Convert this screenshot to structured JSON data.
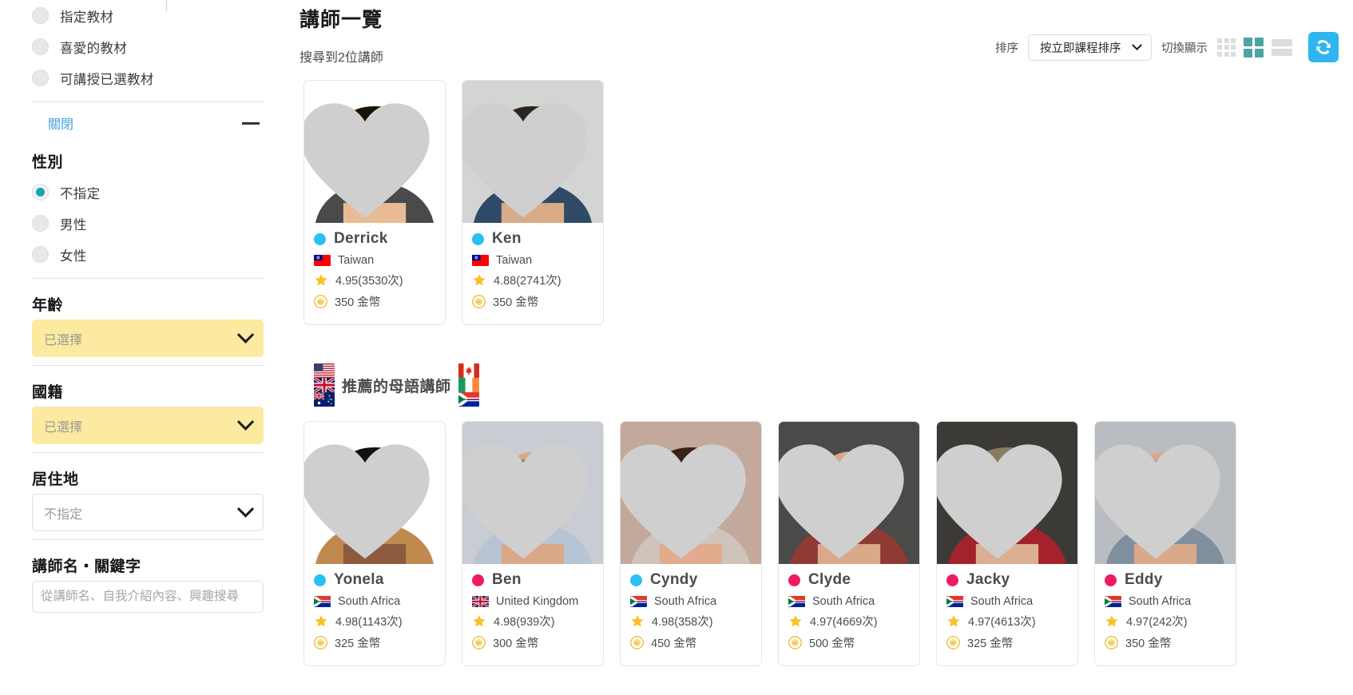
{
  "sidebar": {
    "material_options": [
      {
        "label": "指定教材",
        "checked": false
      },
      {
        "label": "喜愛的教材",
        "checked": false
      },
      {
        "label": "可講授已選教材",
        "checked": false
      }
    ],
    "collapse": {
      "label": "關閉",
      "icon": "minus-icon"
    },
    "gender": {
      "title": "性別",
      "options": [
        {
          "label": "不指定",
          "checked": true
        },
        {
          "label": "男性",
          "checked": false
        },
        {
          "label": "女性",
          "checked": false
        }
      ]
    },
    "age": {
      "title": "年齡",
      "value": "已選擇",
      "highlighted": true
    },
    "nationality": {
      "title": "國籍",
      "value": "已選擇",
      "highlighted": true
    },
    "residence": {
      "title": "居住地",
      "value": "不指定",
      "highlighted": false
    },
    "keyword": {
      "title": "講師名・關鍵字",
      "placeholder": "從講師名、自我介紹內容、興趣搜尋",
      "value": ""
    }
  },
  "main": {
    "page_title": "講師一覽",
    "result_count": "搜尋到2位講師",
    "toolbar": {
      "sort_label": "排序",
      "sort_value": "按立即課程排序",
      "view_label": "切換顯示",
      "views": [
        {
          "name": "grid-3-col",
          "active": false
        },
        {
          "name": "grid-2-col",
          "active": true
        },
        {
          "name": "list-view",
          "active": false
        }
      ],
      "refresh_icon": "refresh-icon"
    },
    "teachers": [
      {
        "name": "Derrick",
        "status_color": "#29c0f2",
        "country": "Taiwan",
        "flag": "tw",
        "rating": "4.95(3530次)",
        "price": "350 金幣",
        "favorite": false
      },
      {
        "name": "Ken",
        "status_color": "#29c0f2",
        "country": "Taiwan",
        "flag": "tw",
        "rating": "4.88(2741次)",
        "price": "350 金幣",
        "favorite": false
      }
    ],
    "recommend_section": {
      "flags_before": [
        "us",
        "gb",
        "au"
      ],
      "title": "推薦的母語講師",
      "flags_after": [
        "ca",
        "ie",
        "za"
      ],
      "teachers": [
        {
          "name": "Yonela",
          "status_color": "#29c0f2",
          "country": "South Africa",
          "flag": "za",
          "rating": "4.98(1143次)",
          "price": "325 金幣",
          "favorite": false
        },
        {
          "name": "Ben",
          "status_color": "#ef1b5e",
          "country": "United Kingdom",
          "flag": "gb",
          "rating": "4.98(939次)",
          "price": "300 金幣",
          "favorite": false
        },
        {
          "name": "Cyndy",
          "status_color": "#29c0f2",
          "country": "South Africa",
          "flag": "za",
          "rating": "4.98(358次)",
          "price": "450 金幣",
          "favorite": false
        },
        {
          "name": "Clyde",
          "status_color": "#ef1b5e",
          "country": "South Africa",
          "flag": "za",
          "rating": "4.97(4669次)",
          "price": "500 金幣",
          "favorite": false
        },
        {
          "name": "Jacky",
          "status_color": "#ef1b5e",
          "country": "South Africa",
          "flag": "za",
          "rating": "4.97(4613次)",
          "price": "325 金幣",
          "favorite": false
        },
        {
          "name": "Eddy",
          "status_color": "#ef1b5e",
          "country": "South Africa",
          "flag": "za",
          "rating": "4.97(242次)",
          "price": "350 金幣",
          "favorite": false
        }
      ]
    }
  },
  "colors": {
    "accent_teal": "#16a7ad",
    "accent_blue": "#3fa0dc",
    "refresh_blue": "#2fb5ef",
    "highlight_yellow": "#fbeaa0",
    "status_online": "#29c0f2",
    "status_busy": "#ef1b5e",
    "star_gold": "#fcc024"
  }
}
